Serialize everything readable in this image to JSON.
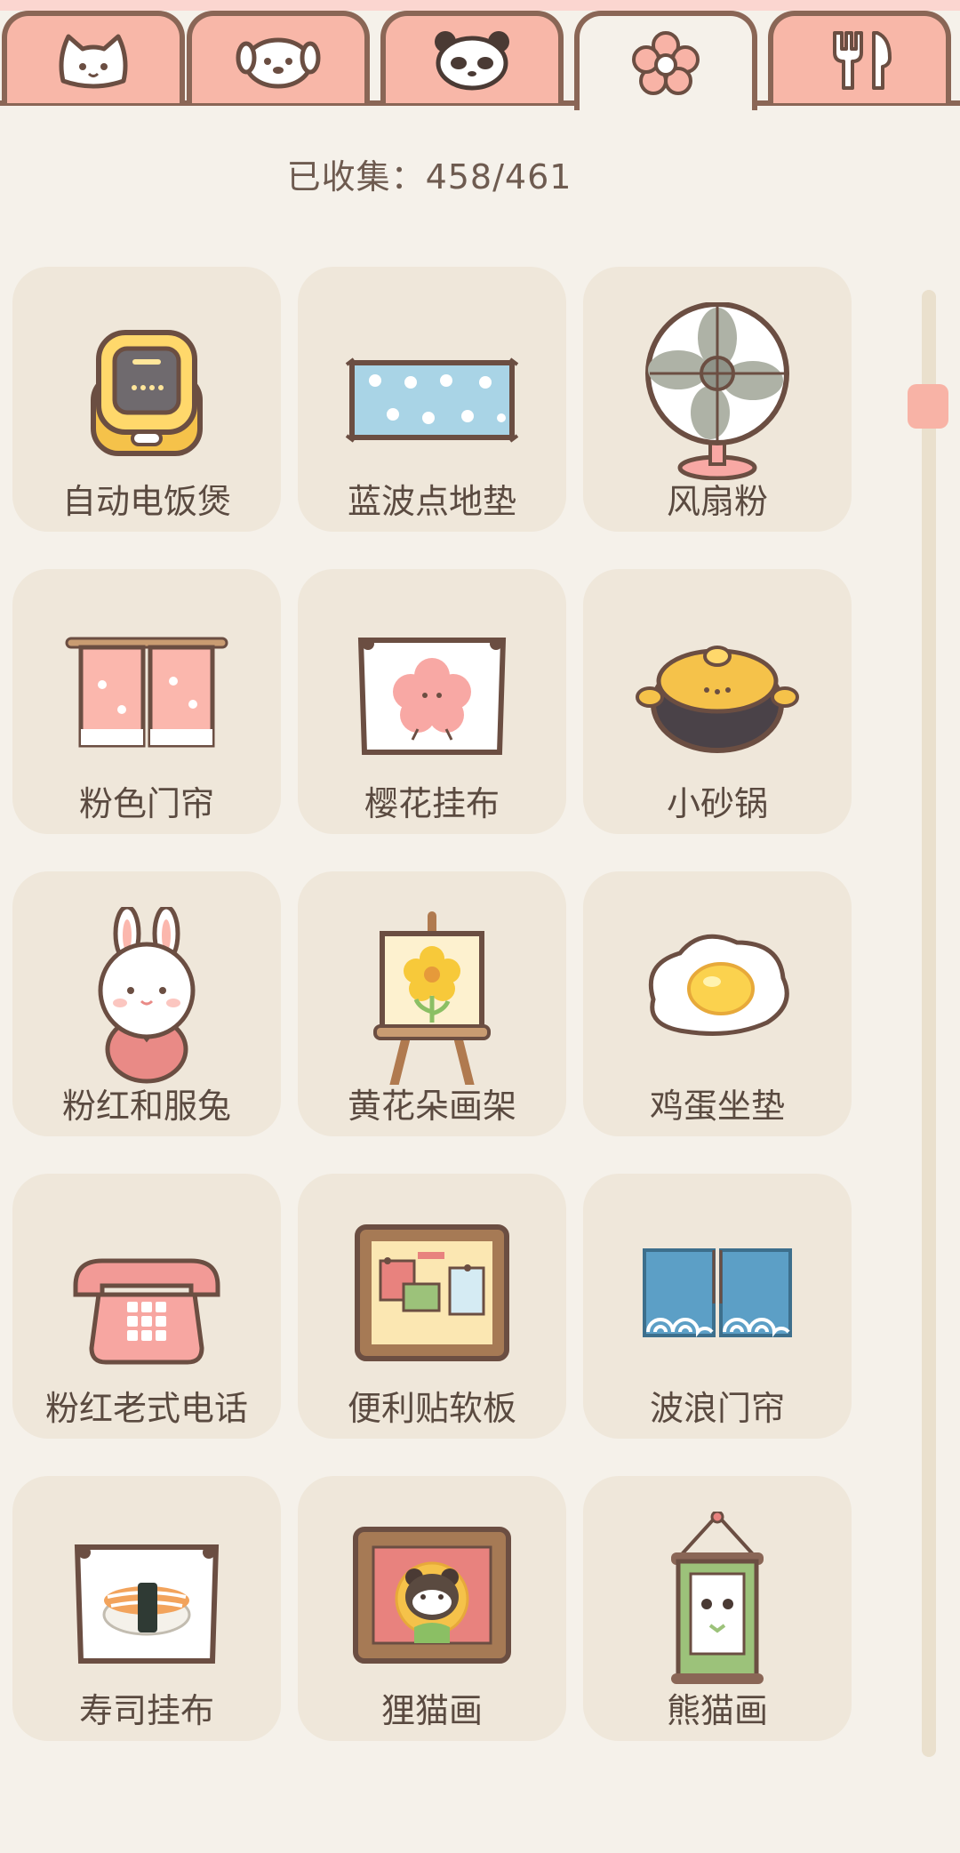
{
  "tabs": [
    {
      "icon": "cat-face-icon",
      "active": false
    },
    {
      "icon": "dog-face-icon",
      "active": false
    },
    {
      "icon": "panda-face-icon",
      "active": false
    },
    {
      "icon": "flower-icon",
      "active": true
    },
    {
      "icon": "fork-spoon-icon",
      "active": false
    }
  ],
  "collection": {
    "label": "已收集：458/461"
  },
  "items": [
    {
      "name": "自动电饭煲",
      "icon": "rice-cooker-icon"
    },
    {
      "name": "蓝波点地垫",
      "icon": "blue-dot-rug-icon"
    },
    {
      "name": "风扇粉",
      "icon": "pink-fan-icon"
    },
    {
      "name": "粉色门帘",
      "icon": "pink-curtain-icon"
    },
    {
      "name": "樱花挂布",
      "icon": "sakura-tapestry-icon"
    },
    {
      "name": "小砂锅",
      "icon": "clay-pot-icon"
    },
    {
      "name": "粉红和服兔",
      "icon": "kimono-rabbit-icon"
    },
    {
      "name": "黄花朵画架",
      "icon": "flower-easel-icon"
    },
    {
      "name": "鸡蛋坐垫",
      "icon": "egg-cushion-icon"
    },
    {
      "name": "粉红老式电话",
      "icon": "pink-phone-icon"
    },
    {
      "name": "便利贴软板",
      "icon": "corkboard-icon"
    },
    {
      "name": "波浪门帘",
      "icon": "wave-curtain-icon"
    },
    {
      "name": "寿司挂布",
      "icon": "sushi-tapestry-icon"
    },
    {
      "name": "狸猫画",
      "icon": "tanuki-painting-icon"
    },
    {
      "name": "熊猫画",
      "icon": "panda-scroll-icon"
    }
  ],
  "colors": {
    "tab_fill": "#f8b7a8",
    "outline": "#8a6656",
    "card": "#efe7da",
    "background": "#f5f1ea",
    "scroll_thumb": "#f8b3a6"
  }
}
